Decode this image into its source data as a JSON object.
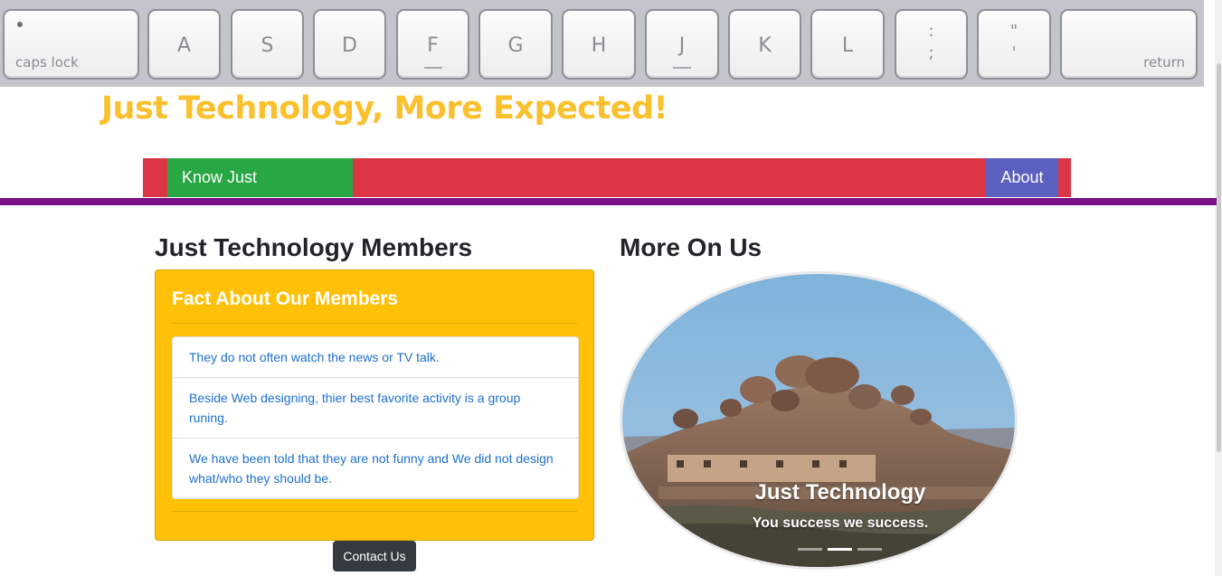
{
  "banner": {
    "keys": [
      {
        "id": "caps",
        "label": "caps lock"
      },
      {
        "id": "a",
        "label": "A"
      },
      {
        "id": "s",
        "label": "S"
      },
      {
        "id": "d",
        "label": "D"
      },
      {
        "id": "f",
        "label": "F"
      },
      {
        "id": "g",
        "label": "G"
      },
      {
        "id": "h",
        "label": "H"
      },
      {
        "id": "j",
        "label": "J"
      },
      {
        "id": "k",
        "label": "K"
      },
      {
        "id": "l",
        "label": "L"
      },
      {
        "id": "semicolon",
        "top": ":",
        "bottom": ";"
      },
      {
        "id": "quote",
        "top": "\"",
        "bottom": "'"
      },
      {
        "id": "return",
        "label": "return"
      }
    ]
  },
  "site_title": "Just Technology, More Expected!",
  "nav": {
    "know_label": "Know Just Technology",
    "about_label": "About",
    "bar_color": "#dc3545",
    "know_color": "#28a745",
    "about_color": "#5b5fbd"
  },
  "members": {
    "heading": "Just Technology Members",
    "card_title": "Fact About Our Members",
    "facts": [
      "They do not often watch the news or TV talk.",
      "Beside Web designing, thier best favorite activity is a group runing.",
      "We have been told that they are not funny and We did not design what/who they should be."
    ]
  },
  "more": {
    "heading": "More On Us",
    "caption_title": "Just Technology",
    "caption_sub": "You success we success."
  },
  "contact_label": "Contact Us"
}
